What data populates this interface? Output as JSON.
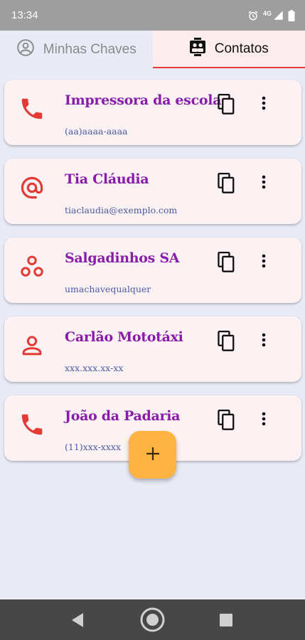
{
  "status_bar": {
    "time": "13:34",
    "network": "4G",
    "icons": [
      "alarm-icon",
      "signal-icon",
      "battery-icon"
    ]
  },
  "tabs": [
    {
      "label": "Minhas Chaves",
      "icon": "account-circle-icon",
      "selected": false
    },
    {
      "label": "Contatos",
      "icon": "contacts-icon",
      "selected": true
    }
  ],
  "contacts": [
    {
      "name": "Impressora da escola",
      "value": "(aa)aaaa-aaaa",
      "type_icon": "phone-icon"
    },
    {
      "name": "Tia Cláudia",
      "value": "tiaclaudia@exemplo.com",
      "type_icon": "at-sign-icon"
    },
    {
      "name": "Salgadinhos SA",
      "value": "umachavequalquer",
      "type_icon": "random-key-icon"
    },
    {
      "name": "Carlão Mototáxi",
      "value": "xxx.xxx.xx-xx",
      "type_icon": "person-icon"
    },
    {
      "name": "João da Padaria",
      "value": "(11)xxx-xxxx",
      "type_icon": "phone-icon"
    }
  ],
  "fab": {
    "icon": "plus-icon"
  },
  "colors": {
    "accent": "#e53935",
    "title": "#8a1cab",
    "subtitle": "#4a5aa8",
    "card_bg": "#fcf1f3",
    "page_bg": "#e8eaf6",
    "fab_bg": "#ffb340"
  }
}
